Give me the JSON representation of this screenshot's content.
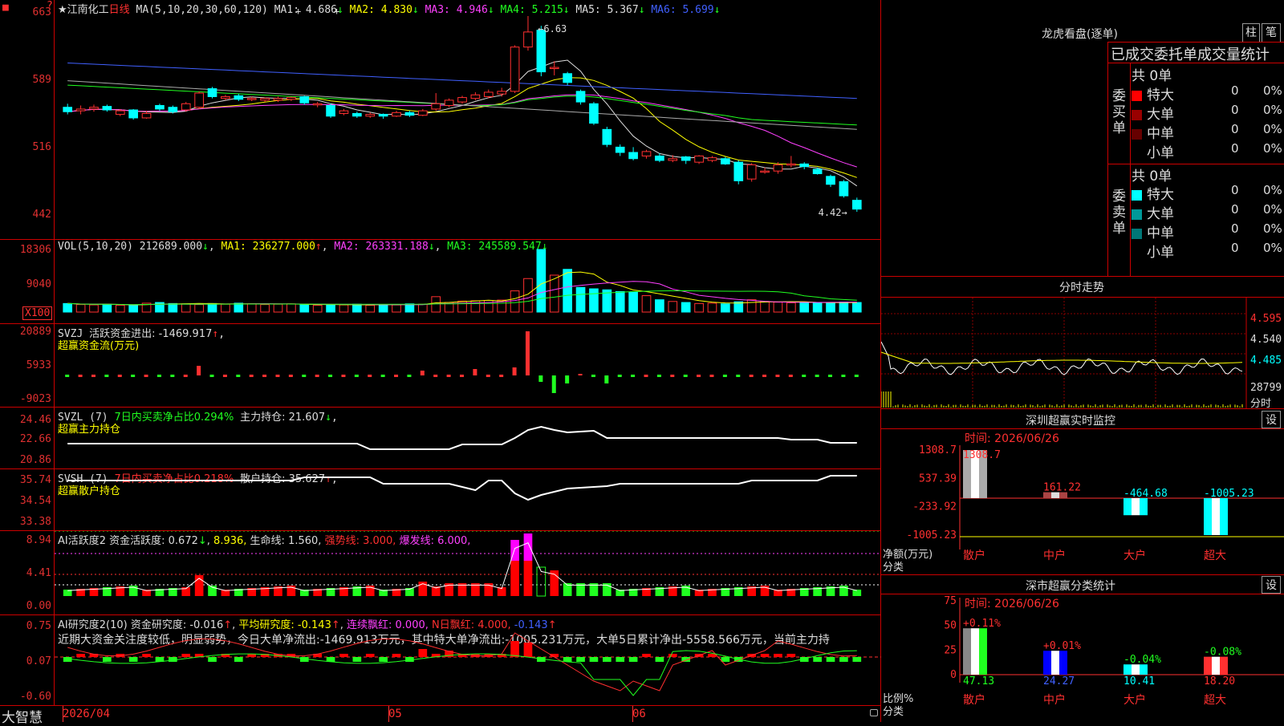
{
  "stock": {
    "star": "★",
    "name": "江南化工",
    "period": "日线"
  },
  "main": {
    "yticks": [
      "663",
      "589",
      "516",
      "442"
    ],
    "ma_header": "MA(5,10,20,30,60,120)",
    "ma": [
      {
        "label": "MA1:",
        "value": "4.686",
        "arrow": "↓",
        "color": "#dddddd"
      },
      {
        "label": "MA2:",
        "value": "4.830",
        "arrow": "↓",
        "color": "#ffff00"
      },
      {
        "label": "MA3:",
        "value": "4.946",
        "arrow": "↓",
        "color": "#ff40ff"
      },
      {
        "label": "MA4:",
        "value": "5.215",
        "arrow": "↓",
        "color": "#20ff20"
      },
      {
        "label": "MA5:",
        "value": "5.367",
        "arrow": "↓",
        "color": "#dddddd"
      },
      {
        "label": "MA6:",
        "value": "5.699",
        "arrow": "↓",
        "color": "#4060ff"
      }
    ],
    "high_label": "6.63",
    "low_label": "4.42"
  },
  "vol": {
    "header": "VOL(5,10,20)",
    "value": "212689.000",
    "arrow": "↓",
    "ma1": "MA1: 236277.000",
    "ma1_arrow": "↑",
    "ma2": "MA2: 263331.188",
    "ma2_arrow": "↓",
    "ma3": "MA3: 245589.547",
    "ma3_arrow": "↓",
    "yticks": [
      "18306",
      "9040"
    ],
    "unit": "X100"
  },
  "svzj": {
    "header": "SVZJ",
    "desc": "活跃资金进出: -1469.917",
    "arrow": "↑",
    "comma": ",",
    "sub": "超赢资金流(万元)",
    "yticks": [
      "20889",
      "5933",
      "-9023"
    ]
  },
  "svzl": {
    "header": "SVZL (7)",
    "desc": "7日内买卖净占比0.294%",
    "pos": "主力持仓: 21.607",
    "arrow": "↓",
    "comma": ",",
    "sub": "超赢主力持仓",
    "yticks": [
      "24.46",
      "22.66",
      "20.86"
    ]
  },
  "svsh": {
    "header": "SVSH (7)",
    "desc": "7日内买卖净占比0.218%",
    "pos": "散户持仓: 35.627",
    "arrow": "↑",
    "comma": ",",
    "sub": "超赢散户持仓",
    "yticks": [
      "35.74",
      "34.54",
      "33.38"
    ]
  },
  "ai1": {
    "header": "AI活跃度2",
    "t1": "资金活跃度: 0.672",
    "a1": "↓",
    "t2": "8.936,",
    "t3": "生命线: 1.560,",
    "t4": "强势线: 3.000,",
    "t5": "爆发线: 6.000,",
    "yticks": [
      "8.94",
      "4.41",
      "0.00"
    ]
  },
  "ai2": {
    "header": "AI研究度2(10)",
    "t1": "资金研究度: -0.016",
    "a1": "↑",
    "t2": "平均研究度: -0.143",
    "a2": "↑",
    "t3": "连续飘红: 0.000,",
    "t4": "N日飘红: 4.000,",
    "t5": "-0.143",
    "a5": "↑",
    "yticks": [
      "0.75",
      "0.07",
      "-0.60"
    ],
    "comment": "近期大资金关注度较低，明显弱势，今日大单净流出:-1469.913万元，其中特大单净流出:-1005.231万元，大单5日累计净出-5558.566万元，当前主力持"
  },
  "xaxis": {
    "labels": [
      "2026/04",
      "05",
      "06"
    ]
  },
  "brand": "大智慧",
  "dragon": {
    "title": "龙虎看盘(逐单)",
    "btn1": "柱",
    "btn2": "笔",
    "subtitle": "已成交委托单成交量统计",
    "buy": {
      "side": "委买单",
      "total": "共 0单",
      "rows": [
        {
          "label": "特大",
          "color": "#ff0000",
          "vol": "0",
          "pct": "0%"
        },
        {
          "label": "大单",
          "color": "#990000",
          "vol": "0",
          "pct": "0%"
        },
        {
          "label": "中单",
          "color": "#660000",
          "vol": "0",
          "pct": "0%"
        },
        {
          "label": "小单",
          "color": "",
          "vol": "0",
          "pct": "0%"
        }
      ]
    },
    "sell": {
      "side": "委卖单",
      "total": "共 0单",
      "rows": [
        {
          "label": "特大",
          "color": "#00ffff",
          "vol": "0",
          "pct": "0%"
        },
        {
          "label": "大单",
          "color": "#009999",
          "vol": "0",
          "pct": "0%"
        },
        {
          "label": "中单",
          "color": "#007777",
          "vol": "0",
          "pct": "0%"
        },
        {
          "label": "小单",
          "color": "",
          "vol": "0",
          "pct": "0%"
        }
      ]
    }
  },
  "intraday": {
    "title": "分时走势",
    "ticks": [
      "4.595",
      "4.540",
      "4.485"
    ],
    "vol": "28799",
    "unit": "分时"
  },
  "monitor": {
    "title": "深圳超赢实时监控",
    "set": "设",
    "time": "时间: 2026/06/26",
    "yticks": [
      "1308.7",
      "537.39",
      "-233.92",
      "-1005.23"
    ],
    "ylabel": "净额(万元)",
    "xlabel": "分类",
    "cats": [
      "散户",
      "中户",
      "大户",
      "超大"
    ],
    "values": [
      "1308.7",
      "161.22",
      "-464.68",
      "-1005.23"
    ]
  },
  "classify": {
    "title": "深市超赢分类统计",
    "set": "设",
    "time": "时间: 2026/06/26",
    "yticks": [
      "75",
      "50",
      "25",
      "0"
    ],
    "ylabel": "比例%",
    "xlabel": "分类",
    "cats": [
      "散户",
      "中户",
      "大户",
      "超大"
    ],
    "pct": [
      "+0.11%",
      "+0.01%",
      "-0.04%",
      "-0.08%"
    ],
    "values": [
      "47.13",
      "24.27",
      "10.41",
      "18.20"
    ]
  },
  "chart_data": {
    "type": "candlestick",
    "title": "江南化工 日线",
    "ylim": [
      4.42,
      6.63
    ],
    "candles": [
      [
        5.6,
        5.55,
        5.64,
        5.52
      ],
      [
        5.56,
        5.58,
        5.62,
        5.52
      ],
      [
        5.58,
        5.6,
        5.63,
        5.55
      ],
      [
        5.61,
        5.57,
        5.63,
        5.55
      ],
      [
        5.52,
        5.56,
        5.58,
        5.5
      ],
      [
        5.57,
        5.48,
        5.58,
        5.46
      ],
      [
        5.48,
        5.53,
        5.56,
        5.47
      ],
      [
        5.62,
        5.58,
        5.64,
        5.56
      ],
      [
        5.6,
        5.55,
        5.62,
        5.53
      ],
      [
        5.57,
        5.64,
        5.66,
        5.55
      ],
      [
        5.6,
        5.76,
        5.78,
        5.58
      ],
      [
        5.81,
        5.72,
        5.83,
        5.7
      ],
      [
        5.7,
        5.72,
        5.74,
        5.68
      ],
      [
        5.73,
        5.69,
        5.75,
        5.67
      ],
      [
        5.69,
        5.7,
        5.72,
        5.67
      ],
      [
        5.68,
        5.7,
        5.71,
        5.66
      ],
      [
        5.68,
        5.7,
        5.72,
        5.66
      ],
      [
        5.69,
        5.71,
        5.72,
        5.67
      ],
      [
        5.72,
        5.65,
        5.73,
        5.63
      ],
      [
        5.63,
        5.64,
        5.66,
        5.6
      ],
      [
        5.62,
        5.5,
        5.64,
        5.48
      ],
      [
        5.53,
        5.56,
        5.58,
        5.51
      ],
      [
        5.53,
        5.5,
        5.55,
        5.48
      ],
      [
        5.5,
        5.52,
        5.54,
        5.48
      ],
      [
        5.52,
        5.5,
        5.53,
        5.47
      ],
      [
        5.5,
        5.54,
        5.56,
        5.49
      ],
      [
        5.54,
        5.51,
        5.56,
        5.49
      ],
      [
        5.51,
        5.56,
        5.58,
        5.5
      ],
      [
        5.58,
        5.64,
        5.76,
        5.56
      ],
      [
        5.62,
        5.68,
        5.7,
        5.6
      ],
      [
        5.66,
        5.71,
        5.73,
        5.64
      ],
      [
        5.7,
        5.74,
        5.77,
        5.68
      ],
      [
        5.72,
        5.77,
        5.8,
        5.7
      ],
      [
        5.75,
        5.78,
        5.82,
        5.72
      ],
      [
        5.78,
        6.28,
        6.3,
        5.76
      ],
      [
        6.28,
        6.45,
        6.63,
        6.24
      ],
      [
        6.47,
        6.0,
        6.52,
        5.95
      ],
      [
        6.05,
        6.05,
        6.12,
        5.96
      ],
      [
        5.98,
        5.88,
        6.0,
        5.85
      ],
      [
        5.78,
        5.66,
        5.8,
        5.63
      ],
      [
        5.64,
        5.42,
        5.66,
        5.4
      ],
      [
        5.35,
        5.18,
        5.38,
        5.15
      ],
      [
        5.15,
        5.09,
        5.18,
        5.05
      ],
      [
        5.09,
        5.02,
        5.15,
        5.0
      ],
      [
        5.05,
        5.1,
        5.12,
        5.02
      ],
      [
        5.05,
        5.0,
        5.08,
        4.98
      ],
      [
        5.0,
        5.02,
        5.06,
        4.98
      ],
      [
        5.04,
        5.0,
        5.05,
        4.96
      ],
      [
        4.98,
        5.05,
        5.06,
        4.96
      ],
      [
        5.0,
        5.03,
        5.05,
        4.98
      ],
      [
        5.02,
        4.96,
        5.04,
        4.95
      ],
      [
        4.98,
        4.77,
        5.0,
        4.73
      ],
      [
        4.79,
        4.95,
        4.97,
        4.76
      ],
      [
        4.88,
        4.88,
        4.92,
        4.85
      ],
      [
        4.88,
        4.95,
        4.98,
        4.85
      ],
      [
        4.95,
        4.96,
        5.05,
        4.92
      ],
      [
        4.96,
        4.93,
        4.98,
        4.9
      ],
      [
        4.9,
        4.85,
        4.92,
        4.84
      ],
      [
        4.82,
        4.73,
        4.84,
        4.7
      ],
      [
        4.76,
        4.6,
        4.78,
        4.58
      ],
      [
        4.55,
        4.45,
        4.58,
        4.42
      ]
    ],
    "volume": [
      2500,
      2200,
      2100,
      2300,
      2000,
      1900,
      2600,
      2800,
      2500,
      2400,
      2200,
      2500,
      2300,
      2600,
      2400,
      2200,
      2300,
      2400,
      2100,
      2000,
      2200,
      2100,
      2300,
      2000,
      2200,
      2100,
      2400,
      2300,
      4500,
      2800,
      3200,
      3300,
      3400,
      3500,
      6200,
      9800,
      18306,
      10800,
      12500,
      7200,
      6800,
      6500,
      6000,
      5800,
      4800,
      3600,
      3100,
      2800,
      2500,
      2600,
      2400,
      3000,
      3600,
      3100,
      2900,
      2700,
      2800,
      2600,
      2700,
      2900,
      2800
    ]
  }
}
